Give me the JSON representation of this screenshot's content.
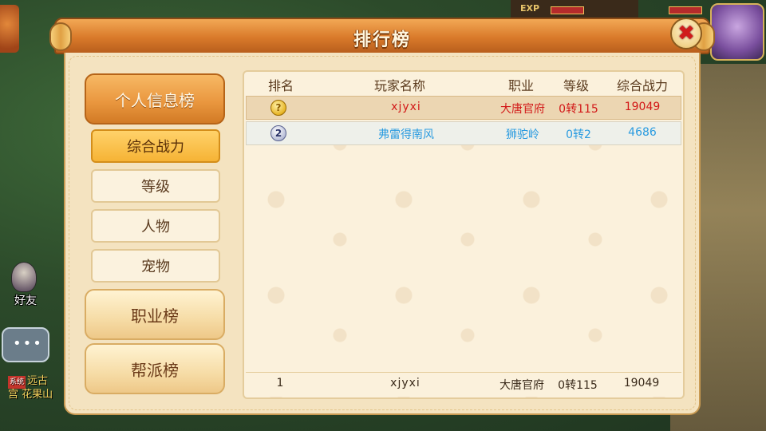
{
  "hud": {
    "exp_label": "EXP"
  },
  "left_ui": {
    "friend_label": "好友",
    "chat_dots": "•••",
    "chat_line1_tag": "系统",
    "chat_line1_text": "远古",
    "chat_line2_text": "宫 花果山"
  },
  "panel": {
    "title": "排行榜",
    "close_symbol": "✖"
  },
  "nav": {
    "main": [
      {
        "label": "个人信息榜",
        "active": true
      },
      {
        "label": "职业榜",
        "active": false
      },
      {
        "label": "帮派榜",
        "active": false
      }
    ],
    "sub": [
      {
        "label": "综合战力",
        "active": true
      },
      {
        "label": "等级",
        "active": false
      },
      {
        "label": "人物",
        "active": false
      },
      {
        "label": "宠物",
        "active": false
      }
    ]
  },
  "table": {
    "headers": {
      "rank": "排名",
      "player": "玩家名称",
      "job": "职业",
      "level": "等级",
      "power": "综合战力"
    },
    "rows": [
      {
        "rank": "1",
        "player": "xjyxi",
        "job": "大唐官府",
        "level": "0转115",
        "power": "19049",
        "color": "#d21818"
      },
      {
        "rank": "2",
        "player": "弗雷得南风",
        "job": "狮驼岭",
        "level": "0转2",
        "power": "4686",
        "color": "#2a9be0"
      }
    ],
    "my_row": {
      "rank": "1",
      "player": "xjyxi",
      "job": "大唐官府",
      "level": "0转115",
      "power": "19049"
    }
  }
}
